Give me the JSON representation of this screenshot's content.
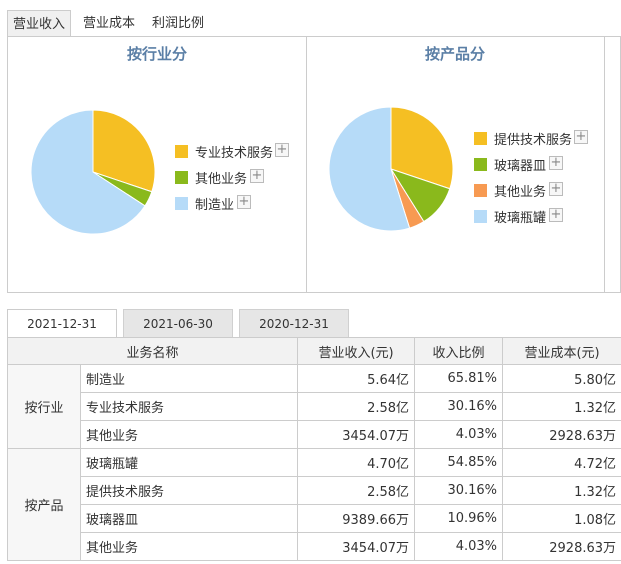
{
  "tabs": [
    "营业收入",
    "营业成本",
    "利润比例"
  ],
  "charts": [
    {
      "title": "按行业分",
      "legend": [
        "专业技术服务",
        "其他业务",
        "制造业"
      ]
    },
    {
      "title": "按产品分",
      "legend": [
        "提供技术服务",
        "玻璃器皿",
        "其他业务",
        "玻璃瓶罐"
      ]
    }
  ],
  "chart_data": [
    {
      "type": "pie",
      "title": "按行业分",
      "slices": [
        {
          "label": "专业技术服务",
          "value": 30.16,
          "color": "#f5bf23"
        },
        {
          "label": "其他业务",
          "value": 4.03,
          "color": "#8ab91c"
        },
        {
          "label": "制造业",
          "value": 65.81,
          "color": "#b6dbf8"
        }
      ]
    },
    {
      "type": "pie",
      "title": "按产品分",
      "slices": [
        {
          "label": "提供技术服务",
          "value": 30.16,
          "color": "#f5bf23"
        },
        {
          "label": "玻璃器皿",
          "value": 10.96,
          "color": "#8ab91c"
        },
        {
          "label": "其他业务",
          "value": 4.03,
          "color": "#f79a52"
        },
        {
          "label": "玻璃瓶罐",
          "value": 54.85,
          "color": "#b6dbf8"
        }
      ]
    }
  ],
  "date_tabs": [
    "2021-12-31",
    "2021-06-30",
    "2020-12-31"
  ],
  "table": {
    "headers": [
      "业务名称",
      "营业收入(元)",
      "收入比例",
      "营业成本(元)"
    ],
    "groups": [
      {
        "label": "按行业",
        "rows": [
          {
            "name": "制造业",
            "revenue": "5.64亿",
            "ratio": "65.81%",
            "cost": "5.80亿"
          },
          {
            "name": "专业技术服务",
            "revenue": "2.58亿",
            "ratio": "30.16%",
            "cost": "1.32亿"
          },
          {
            "name": "其他业务",
            "revenue": "3454.07万",
            "ratio": "4.03%",
            "cost": "2928.63万"
          }
        ]
      },
      {
        "label": "按产品",
        "rows": [
          {
            "name": "玻璃瓶罐",
            "revenue": "4.70亿",
            "ratio": "54.85%",
            "cost": "4.72亿"
          },
          {
            "name": "提供技术服务",
            "revenue": "2.58亿",
            "ratio": "30.16%",
            "cost": "1.32亿"
          },
          {
            "name": "玻璃器皿",
            "revenue": "9389.66万",
            "ratio": "10.96%",
            "cost": "1.08亿"
          },
          {
            "name": "其他业务",
            "revenue": "3454.07万",
            "ratio": "4.03%",
            "cost": "2928.63万"
          }
        ]
      }
    ]
  }
}
